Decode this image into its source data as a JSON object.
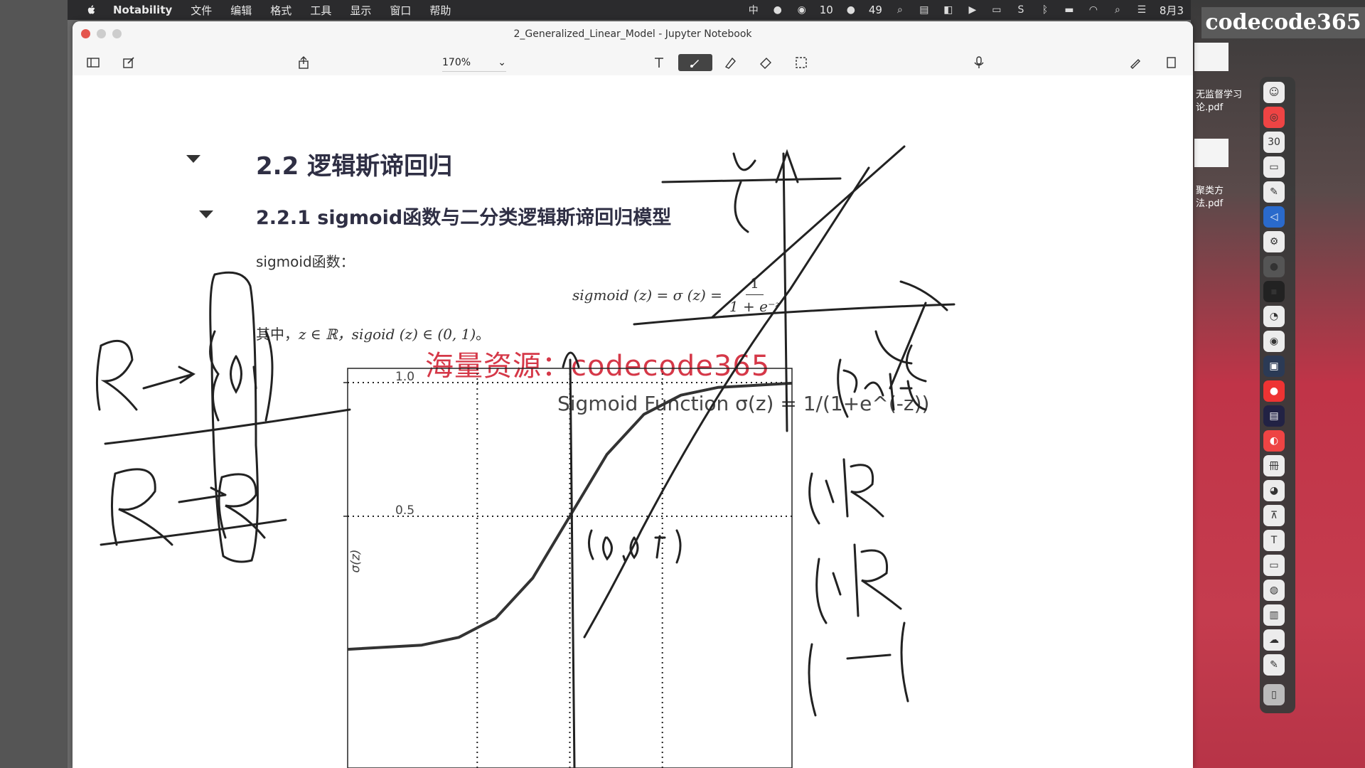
{
  "menubar": {
    "app": "Notability",
    "items": [
      "文件",
      "编辑",
      "格式",
      "工具",
      "显示",
      "窗口",
      "帮助"
    ],
    "input_method": "中",
    "wechat_count": "10",
    "notif_count": "49",
    "date": "8月3"
  },
  "brand": "codecode365",
  "window": {
    "title": "2_Generalized_Linear_Model - Jupyter Notebook",
    "zoom": "170%"
  },
  "notebook": {
    "section_title": "2.2 逻辑斯谛回归",
    "subsection_title": "2.2.1 sigmoid函数与二分类逻辑斯谛回归模型",
    "sigmoid_label": "sigmoid函数：",
    "formula_lhs": "sigmoid (z) = σ (z) =",
    "formula_num": "1",
    "formula_den": "1 + e⁻ᶻ",
    "where_prefix": "其中，",
    "where_math": "z ∈ ℝ，sigoid (z) ∈ (0, 1)",
    "where_suffix": "。",
    "watermark": "海量资源：codecode365"
  },
  "chart_data": {
    "type": "line",
    "title": "Sigmoid Function σ(z) = 1/(1+e^(-z))",
    "ylabel": "σ(z)",
    "yticks": [
      "1.0",
      "0.5"
    ],
    "ylim": [
      0,
      1.0
    ],
    "xlim": [
      -6,
      6
    ],
    "grid": "dotted",
    "series": [
      {
        "values": [
          [
            -6,
            0.0025
          ],
          [
            -4,
            0.018
          ],
          [
            -3,
            0.047
          ],
          [
            -2,
            0.119
          ],
          [
            -1,
            0.269
          ],
          [
            0,
            0.5
          ],
          [
            1,
            0.731
          ],
          [
            2,
            0.881
          ],
          [
            3,
            0.953
          ],
          [
            4,
            0.982
          ],
          [
            6,
            0.9975
          ]
        ]
      }
    ]
  },
  "handwriting": {
    "notes": [
      "R → {0,1}",
      "R → R",
      "(0, 0.5)",
      "y = ax+b",
      "σ ∈ R",
      "y ∈ R",
      "R → R"
    ]
  },
  "desktop": {
    "files": [
      "无监督学习",
      "论.pdf",
      "聚类方",
      "法.pdf"
    ],
    "calendar_day": "30"
  },
  "colors": {
    "watermark": "#d53848",
    "menubar": "#2b2b2d",
    "desktop_red": "#c53c4e"
  }
}
